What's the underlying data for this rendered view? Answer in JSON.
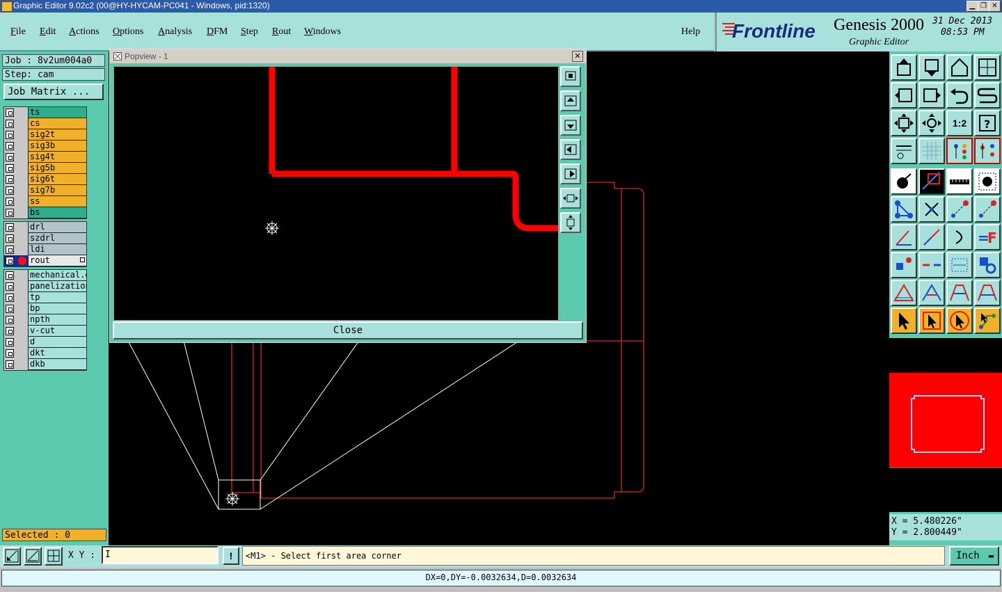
{
  "window": {
    "title": "Graphic Editor 9.02c2 (00@HY-HYCAM-PC041 - Windows, pid:1320)"
  },
  "menu": {
    "items": [
      "File",
      "Edit",
      "Actions",
      "Options",
      "Analysis",
      "DFM",
      "Step",
      "Rout",
      "Windows"
    ],
    "help": "Help"
  },
  "logo": {
    "brand": "Frontline",
    "product": "Genesis 2000",
    "subtitle": "Graphic Editor",
    "date": "31 Dec 2013",
    "time": "08:53 PM"
  },
  "job": {
    "label": "Job : 8v2um004a0",
    "step": "Step: cam",
    "matrix_button": "Job Matrix ..."
  },
  "layers": {
    "board": [
      {
        "name": "ts",
        "color": "#2fae8f"
      },
      {
        "name": "cs",
        "color": "#f0b028"
      },
      {
        "name": "sig2t",
        "color": "#f0b028"
      },
      {
        "name": "sig3b",
        "color": "#f0b028"
      },
      {
        "name": "sig4t",
        "color": "#f0b028"
      },
      {
        "name": "sig5b",
        "color": "#f0b028"
      },
      {
        "name": "sig6t",
        "color": "#f0b028"
      },
      {
        "name": "sig7b",
        "color": "#f0b028"
      },
      {
        "name": "ss",
        "color": "#f0b028"
      },
      {
        "name": "bs",
        "color": "#2fae8f"
      }
    ],
    "drill": [
      {
        "name": "drl",
        "color": "#b0c4cc"
      },
      {
        "name": "szdrl",
        "color": "#b0c4cc"
      },
      {
        "name": "ldi",
        "color": "#b0c4cc"
      },
      {
        "name": "rout",
        "color": "#e8e8e8",
        "active": true
      }
    ],
    "misc": [
      {
        "name": "mechanical.d",
        "color": "#a8e0dc"
      },
      {
        "name": "panelization",
        "color": "#a8e0dc"
      },
      {
        "name": "tp",
        "color": "#a8e0dc"
      },
      {
        "name": "bp",
        "color": "#a8e0dc"
      },
      {
        "name": "npth",
        "color": "#a8e0dc"
      },
      {
        "name": "v-cut",
        "color": "#a8e0dc"
      },
      {
        "name": "d",
        "color": "#a8e0dc"
      },
      {
        "name": "dkt",
        "color": "#a8e0dc"
      },
      {
        "name": "dkb",
        "color": "#a8e0dc"
      }
    ]
  },
  "selected": "Selected : 0",
  "popview": {
    "title": "Popview - 1",
    "close_label": "Close"
  },
  "coords": {
    "x": "X = 5.480226\"",
    "y": "Y = 2.800449\""
  },
  "bottom": {
    "xy_label": "X Y :",
    "xy_value": "I",
    "excl": "!",
    "prompt": "<M1> - Select first area corner",
    "units": "Inch",
    "status": "DX=0,DY=-0.0032634,D=0.0032634"
  },
  "right_tool_label": "1:2"
}
